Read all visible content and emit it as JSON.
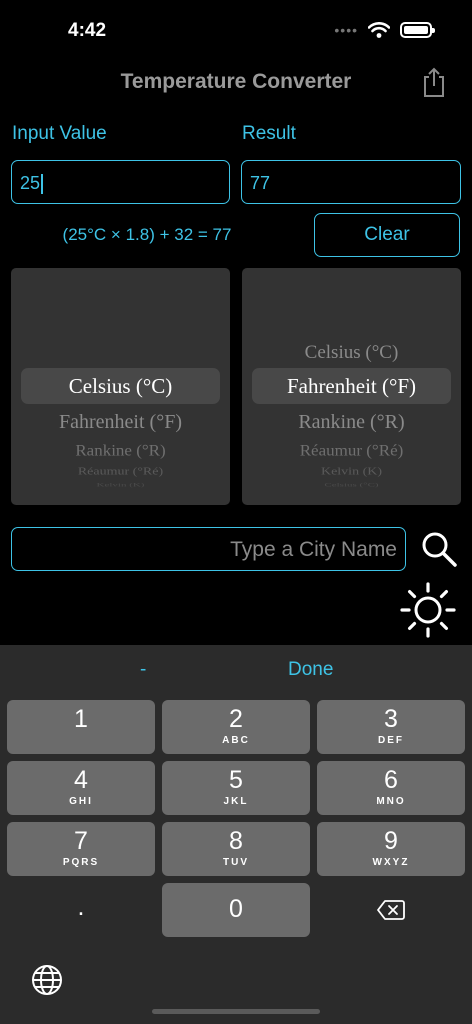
{
  "status_bar": {
    "time": "4:42",
    "dots": "••••"
  },
  "nav": {
    "title": "Temperature Converter",
    "share_icon": "share-icon"
  },
  "input": {
    "label": "Input Value",
    "value": "25"
  },
  "result": {
    "label": "Result",
    "value": "77"
  },
  "formula": "(25°C × 1.8) + 32 = 77",
  "clear_label": "Clear",
  "from_picker": {
    "selected": "Celsius (°C)",
    "rows_below": [
      "Fahrenheit (°F)",
      "Rankine (°R)",
      "Réaumur (°Ré)",
      "Kelvin (K)"
    ]
  },
  "to_picker": {
    "rows_above": [
      "Celsius (°C)"
    ],
    "selected": "Fahrenheit (°F)",
    "rows_below": [
      "Rankine (°R)",
      "Réaumur (°Ré)",
      "Kelvin (K)",
      "Celsius (°C)"
    ]
  },
  "city_search": {
    "placeholder": "Type a City Name",
    "search_icon": "search-icon",
    "weather_icon": "sun-icon"
  },
  "keyboard": {
    "toolbar": {
      "minus": "-",
      "done": "Done"
    },
    "keys": [
      {
        "digit": "1",
        "letters": ""
      },
      {
        "digit": "2",
        "letters": "ABC"
      },
      {
        "digit": "3",
        "letters": "DEF"
      },
      {
        "digit": "4",
        "letters": "GHI"
      },
      {
        "digit": "5",
        "letters": "JKL"
      },
      {
        "digit": "6",
        "letters": "MNO"
      },
      {
        "digit": "7",
        "letters": "PQRS"
      },
      {
        "digit": "8",
        "letters": "TUV"
      },
      {
        "digit": "9",
        "letters": "WXYZ"
      }
    ],
    "dot": ".",
    "zero": "0",
    "delete_icon": "backspace-icon",
    "globe_icon": "globe-icon"
  },
  "colors": {
    "accent": "#3ec3e6",
    "background": "#000000",
    "keyboard": "#2b2b2b",
    "key": "#6b6b6b"
  }
}
